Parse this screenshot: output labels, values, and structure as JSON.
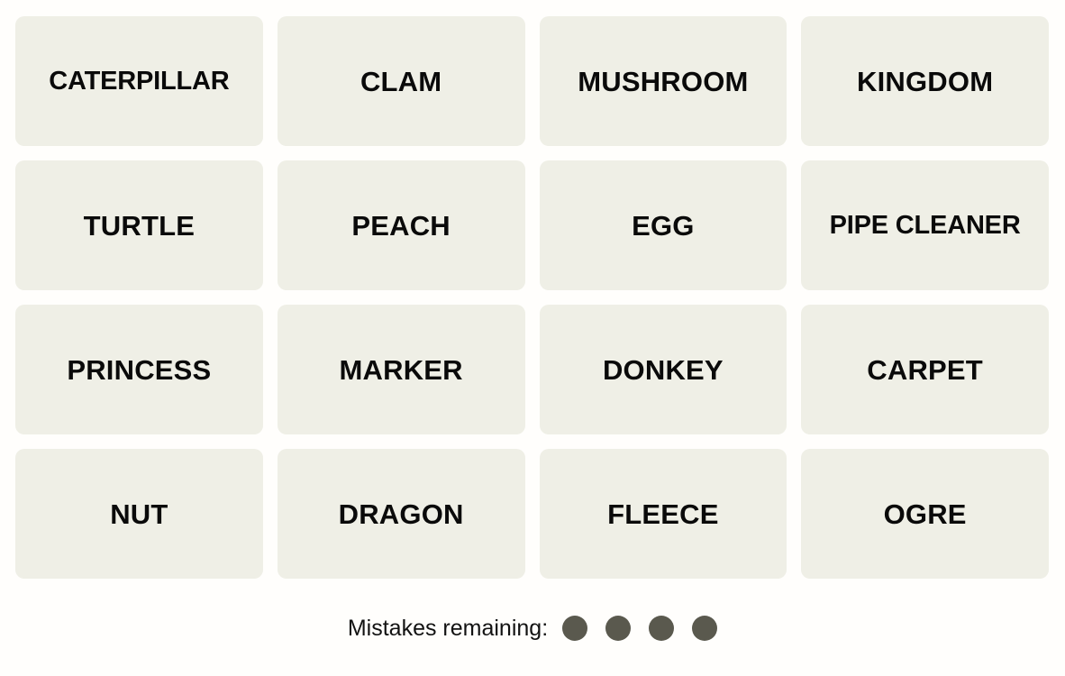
{
  "game": {
    "name": "Connections",
    "tile_bg_color": "#EFEFE6",
    "page_bg_color": "#FFFEFC",
    "tile_text_color": "#0A0A0A",
    "mistake_dot_color": "#5A594E"
  },
  "grid": {
    "columns": 4,
    "rows": 4,
    "tiles": [
      {
        "label": "CATERPILLAR",
        "row": 1,
        "col": 1,
        "selected": false
      },
      {
        "label": "CLAM",
        "row": 1,
        "col": 2,
        "selected": false
      },
      {
        "label": "MUSHROOM",
        "row": 1,
        "col": 3,
        "selected": false
      },
      {
        "label": "KINGDOM",
        "row": 1,
        "col": 4,
        "selected": false
      },
      {
        "label": "TURTLE",
        "row": 2,
        "col": 1,
        "selected": false
      },
      {
        "label": "PEACH",
        "row": 2,
        "col": 2,
        "selected": false
      },
      {
        "label": "EGG",
        "row": 2,
        "col": 3,
        "selected": false
      },
      {
        "label": "PIPE CLEANER",
        "row": 2,
        "col": 4,
        "selected": false
      },
      {
        "label": "PRINCESS",
        "row": 3,
        "col": 1,
        "selected": false
      },
      {
        "label": "MARKER",
        "row": 3,
        "col": 2,
        "selected": false
      },
      {
        "label": "DONKEY",
        "row": 3,
        "col": 3,
        "selected": false
      },
      {
        "label": "CARPET",
        "row": 3,
        "col": 4,
        "selected": false
      },
      {
        "label": "NUT",
        "row": 4,
        "col": 1,
        "selected": false
      },
      {
        "label": "DRAGON",
        "row": 4,
        "col": 2,
        "selected": false
      },
      {
        "label": "FLEECE",
        "row": 4,
        "col": 3,
        "selected": false
      },
      {
        "label": "OGRE",
        "row": 4,
        "col": 4,
        "selected": false
      }
    ]
  },
  "mistakes": {
    "label": "Mistakes remaining:",
    "remaining": 4,
    "dots": [
      1,
      2,
      3,
      4
    ]
  }
}
